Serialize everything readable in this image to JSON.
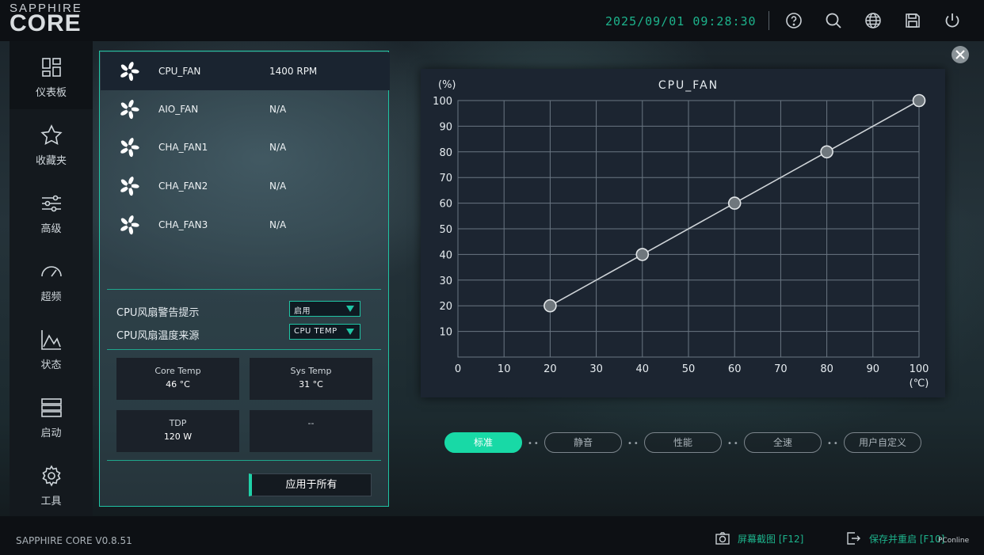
{
  "app": {
    "brand_small": "SAPPHIRE",
    "brand_big": "CORE",
    "datetime": "2025/09/01 09:28:30",
    "toolbar_icons": [
      "help-icon",
      "search-icon",
      "globe-icon",
      "save-icon",
      "power-icon"
    ]
  },
  "nav": {
    "items": [
      {
        "label": "仪表板",
        "icon": "dashboard-icon",
        "active": true
      },
      {
        "label": "收藏夹",
        "icon": "star-icon",
        "active": false
      },
      {
        "label": "高级",
        "icon": "sliders-icon",
        "active": false
      },
      {
        "label": "超频",
        "icon": "speedometer-icon",
        "active": false
      },
      {
        "label": "状态",
        "icon": "chart-icon",
        "active": false
      },
      {
        "label": "启动",
        "icon": "boot-icon",
        "active": false
      },
      {
        "label": "工具",
        "icon": "gear-icon",
        "active": false
      }
    ]
  },
  "fans": [
    {
      "name": "CPU_FAN",
      "value": "1400 RPM",
      "selected": true
    },
    {
      "name": "AIO_FAN",
      "value": "N/A",
      "selected": false
    },
    {
      "name": "CHA_FAN1",
      "value": "N/A",
      "selected": false
    },
    {
      "name": "CHA_FAN2",
      "value": "N/A",
      "selected": false
    },
    {
      "name": "CHA_FAN3",
      "value": "N/A",
      "selected": false
    }
  ],
  "settings": {
    "warning_label": "CPU风扇警告提示",
    "warning_value": "启用",
    "source_label": "CPU风扇温度来源",
    "source_value": "CPU TEMP"
  },
  "stats": {
    "core_temp_label": "Core Temp",
    "core_temp_value": "46 °C",
    "sys_temp_label": "Sys Temp",
    "sys_temp_value": "31 °C",
    "tdp_label": "TDP",
    "tdp_value": "120 W",
    "empty_value": "--"
  },
  "apply_label": "应用于所有",
  "chart_data": {
    "type": "line",
    "title": "CPU_FAN",
    "ylabel": "(%)",
    "xlabel": "(℃)",
    "x_ticks": [
      0,
      10,
      20,
      30,
      40,
      50,
      60,
      70,
      80,
      90,
      100
    ],
    "y_ticks": [
      10,
      20,
      30,
      40,
      50,
      60,
      70,
      80,
      90,
      100
    ],
    "xlim": [
      0,
      100
    ],
    "ylim": [
      0,
      100
    ],
    "grid": true,
    "series": [
      {
        "x": [
          20,
          40,
          60,
          80,
          100
        ],
        "values": [
          20,
          40,
          60,
          80,
          100
        ]
      }
    ],
    "colors": {
      "line": "#cfd4d8",
      "point": "#6f777d",
      "grid": "#6a7682",
      "text": "#e6ecf0"
    }
  },
  "modes": [
    {
      "label": "标准",
      "active": true
    },
    {
      "label": "静音",
      "active": false
    },
    {
      "label": "性能",
      "active": false
    },
    {
      "label": "全速",
      "active": false
    },
    {
      "label": "用户自定义",
      "active": false
    }
  ],
  "footer": {
    "version": "SAPPHIRE CORE V0.8.51",
    "screenshot_label": "屏幕截图 [F12]",
    "save_label": "保存并重启 [F10]",
    "watermark": "PConline"
  },
  "colors": {
    "accent": "#1fd1a8",
    "datetime": "#1db38c"
  }
}
